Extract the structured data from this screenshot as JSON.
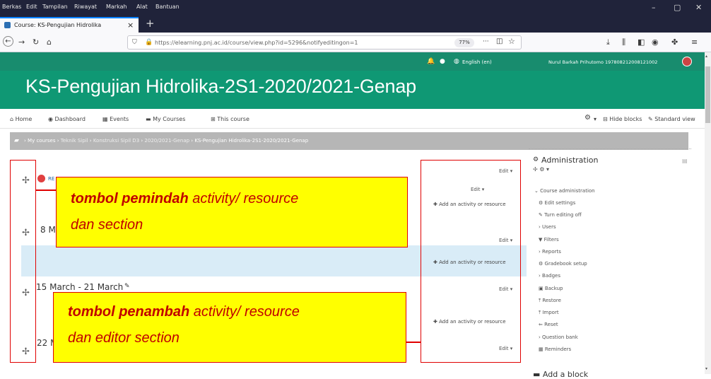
{
  "menubar": {
    "items": [
      "Berkas",
      "Edit",
      "Tampilan",
      "Riwayat",
      "Markah",
      "Alat",
      "Bantuan"
    ],
    "win_minimize": "–",
    "win_maximize": "▢",
    "win_close": "✕"
  },
  "tab": {
    "title": "Course: KS-Pengujian Hidrolika",
    "close": "×",
    "new_tab": "+"
  },
  "navbar": {
    "url": "https://elearning.pnj.ac.id/course/view.php?id=5296&notifyeditingon=1",
    "zoom": "77%",
    "more": "···"
  },
  "moodle_top": {
    "language": "English (en)",
    "user": "Nurul Barkah Prihutomo 197808212008121002"
  },
  "page_title": "KS-Pengujian Hidrolika-2S1-2020/2021-Genap",
  "moodle_nav": {
    "home": "Home",
    "dashboard": "Dashboard",
    "events": "Events",
    "my_courses": "My Courses",
    "this_course": "This course",
    "hide_blocks": "Hide blocks",
    "standard_view": "Standard view"
  },
  "breadcrumb": [
    "My courses",
    "Teknik Sipil",
    "Konstruksi Sipil D3",
    "2020/2021-Genap",
    "KS-Pengujian Hidrolika-2S1-2020/2021-Genap"
  ],
  "sections": {
    "sec1_label": "8 Ma",
    "sec2_label": "15 March - 21 March",
    "sec3_label": "22 M",
    "topic_ref": "RE"
  },
  "actions": {
    "edit": "Edit",
    "add_activity": "Add an activity or resource"
  },
  "admin": {
    "title": "Administration",
    "group": "Course administration",
    "items": [
      "Edit settings",
      "Turn editing off",
      "Users",
      "Filters",
      "Reports",
      "Gradebook setup",
      "Badges",
      "Backup",
      "Restore",
      "Import",
      "Reset",
      "Question bank",
      "Reminders"
    ],
    "add_block": "Add a block"
  },
  "callouts": {
    "mover_bold": "tombol pemindah",
    "mover_rest1": " activity/ resource",
    "mover_line2": "dan section",
    "adder_bold": "tombol penambah",
    "adder_rest1": " activity/ resource",
    "adder_line2": "dan editor section"
  }
}
